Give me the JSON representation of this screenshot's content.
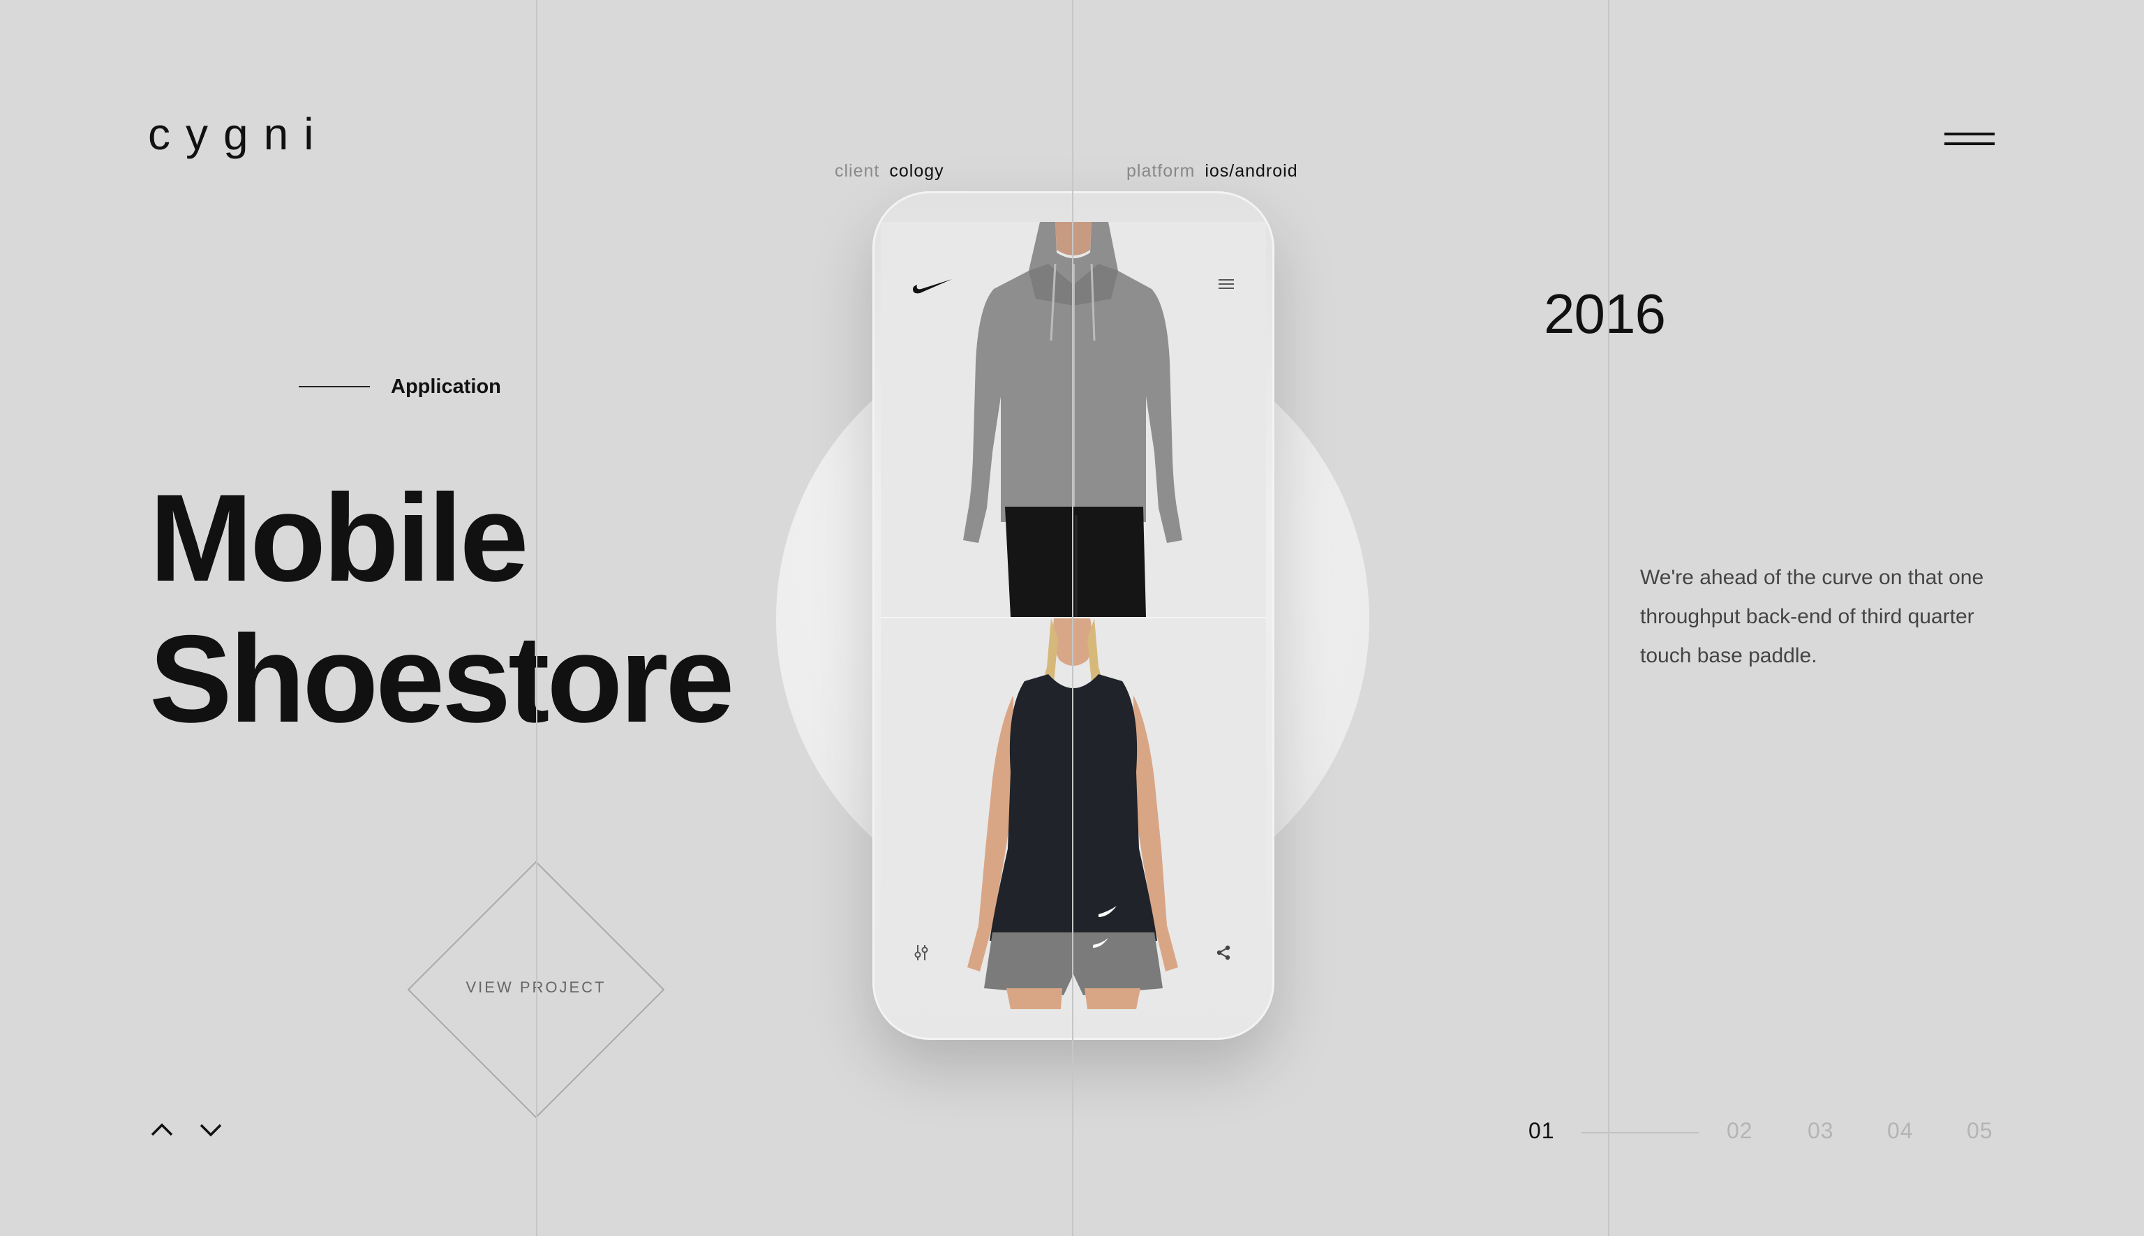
{
  "brand": {
    "logo": "cygni"
  },
  "project": {
    "category": "Application",
    "title_line1": "Mobile",
    "title_line2": "Shoestore",
    "year": "2016",
    "description": "We're ahead of the curve on that one throughput back-end of third quarter touch base paddle.",
    "cta": "VIEW PROJECT"
  },
  "meta": {
    "client_label": "client",
    "client_value": "cology",
    "platform_label": "platform",
    "platform_value": "ios/android"
  },
  "pagination": {
    "current": "01",
    "pages": [
      "02",
      "03",
      "04",
      "05"
    ]
  },
  "icons": {
    "menu": "hamburger-menu-icon",
    "nav_up": "chevron-up-icon",
    "nav_down": "chevron-down-icon",
    "app_logo": "swoosh-logo-icon",
    "app_menu": "hamburger-menu-icon",
    "app_filter": "filter-icon",
    "app_share": "share-icon"
  },
  "colors": {
    "background": "#d9d9d9",
    "text_primary": "#111111",
    "text_muted": "#8a8a8a",
    "inactive_page": "#b4b4b4"
  }
}
